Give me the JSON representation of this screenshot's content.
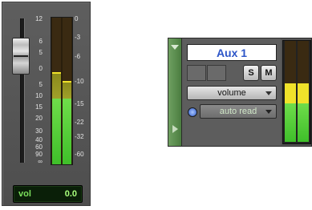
{
  "fader_strip": {
    "fader_scale": [
      "12",
      "6",
      "5",
      "0",
      "5",
      "10",
      "15",
      "20",
      "30",
      "40",
      "60",
      "90",
      "∞"
    ],
    "meter_scale": [
      "0",
      "-3",
      "-6",
      "-10",
      "-15",
      "-22",
      "-32",
      "-60"
    ],
    "meter_level_pct": [
      0.45,
      0.45
    ],
    "peak_level_pct": [
      0.62,
      0.56
    ],
    "volume_label": "vol",
    "volume_value": "0.0"
  },
  "aux_strip": {
    "track_name": "Aux 1",
    "solo_label": "S",
    "mute_label": "M",
    "view_select": "volume",
    "automation_mode": "auto read",
    "meter_level_pct": [
      0.38,
      0.38
    ],
    "meter_yellow_pct": [
      0.2,
      0.2
    ]
  },
  "colors": {
    "track_color": "#5e9150",
    "meter_green": "#4fcf36",
    "meter_yellow": "#f0e22a",
    "name_text": "#2c55c8"
  }
}
